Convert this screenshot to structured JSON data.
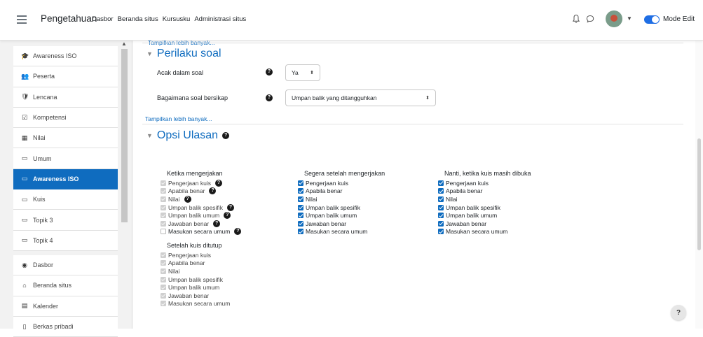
{
  "topbar": {
    "brand": "Pengetahuan",
    "nav": [
      "Dasbor",
      "Beranda situs",
      "Kursusku",
      "Administrasi situs"
    ],
    "mode_label": "Mode Edit",
    "icons": [
      "menu-icon",
      "bell-icon",
      "chat-icon",
      "avatar",
      "toggle"
    ]
  },
  "drawer": {
    "items": [
      {
        "label": "Awareness ISO",
        "icon": "graduation-cap-icon",
        "glyph": "🎓"
      },
      {
        "label": "Peserta",
        "icon": "users-icon",
        "glyph": "👥"
      },
      {
        "label": "Lencana",
        "icon": "shield-icon",
        "glyph": "🛡"
      },
      {
        "label": "Kompetensi",
        "icon": "checkbox-icon",
        "glyph": "☑"
      },
      {
        "label": "Nilai",
        "icon": "table-icon",
        "glyph": "▦"
      },
      {
        "label": "Umum",
        "icon": "folder-icon",
        "glyph": "▭"
      },
      {
        "label": "Awareness ISO",
        "icon": "folder-icon",
        "glyph": "▭",
        "active": true
      },
      {
        "label": "Kuis",
        "icon": "folder-icon",
        "glyph": "▭"
      },
      {
        "label": "Topik 3",
        "icon": "folder-icon",
        "glyph": "▭"
      },
      {
        "label": "Topik 4",
        "icon": "folder-icon",
        "glyph": "▭"
      },
      {
        "label": "Dasbor",
        "icon": "dashboard-icon",
        "glyph": "◉"
      },
      {
        "label": "Beranda situs",
        "icon": "home-icon",
        "glyph": "⌂"
      },
      {
        "label": "Kalender",
        "icon": "calendar-icon",
        "glyph": "▤"
      },
      {
        "label": "Berkas pribadi",
        "icon": "file-icon",
        "glyph": "▯"
      }
    ]
  },
  "main": {
    "show_more_1": "Tampilkan lebih banyak...",
    "perilaku": {
      "title": "Perilaku soal",
      "acak_label": "Acak dalam soal",
      "acak_value": "Ya",
      "bagaimana_label": "Bagaimana soal bersikap",
      "bagaimana_value": "Umpan balik yang ditangguhkan"
    },
    "show_more_2": "Tampilkan lebih banyak...",
    "opsi": {
      "title": "Opsi Ulasan",
      "columns": [
        {
          "title": "Ketika mengerjakan",
          "items": [
            {
              "label": "Pengerjaan kuis",
              "state": "disabled",
              "help": true
            },
            {
              "label": "Apabila benar",
              "state": "disabled",
              "help": true
            },
            {
              "label": "Nilai",
              "state": "disabled",
              "help": true
            },
            {
              "label": "Umpan balik spesifik",
              "state": "disabled",
              "help": true
            },
            {
              "label": "Umpan balik umum",
              "state": "disabled",
              "help": true
            },
            {
              "label": "Jawaban benar",
              "state": "disabled",
              "help": true
            },
            {
              "label": "Masukan secara umum",
              "state": "empty",
              "help": true
            }
          ]
        },
        {
          "title": "Segera setelah mengerjakan",
          "items": [
            {
              "label": "Pengerjaan kuis",
              "state": "checked"
            },
            {
              "label": "Apabila benar",
              "state": "checked"
            },
            {
              "label": "Nilai",
              "state": "checked"
            },
            {
              "label": "Umpan balik spesifik",
              "state": "checked"
            },
            {
              "label": "Umpan balik umum",
              "state": "checked"
            },
            {
              "label": "Jawaban benar",
              "state": "checked"
            },
            {
              "label": "Masukan secara umum",
              "state": "checked"
            }
          ]
        },
        {
          "title": "Nanti, ketika kuis masih dibuka",
          "items": [
            {
              "label": "Pengerjaan kuis",
              "state": "checked"
            },
            {
              "label": "Apabila benar",
              "state": "checked"
            },
            {
              "label": "Nilai",
              "state": "checked"
            },
            {
              "label": "Umpan balik spesifik",
              "state": "checked"
            },
            {
              "label": "Umpan balik umum",
              "state": "checked"
            },
            {
              "label": "Jawaban benar",
              "state": "checked"
            },
            {
              "label": "Masukan secara umum",
              "state": "checked"
            }
          ]
        },
        {
          "title": "Setelah kuis ditutup",
          "items": [
            {
              "label": "Pengerjaan kuis",
              "state": "disabled"
            },
            {
              "label": "Apabila benar",
              "state": "disabled"
            },
            {
              "label": "Nilai",
              "state": "disabled"
            },
            {
              "label": "Umpan balik spesifik",
              "state": "disabled"
            },
            {
              "label": "Umpan balik umum",
              "state": "disabled"
            },
            {
              "label": "Jawaban benar",
              "state": "disabled"
            },
            {
              "label": "Masukan secara umum",
              "state": "disabled"
            }
          ]
        }
      ]
    }
  },
  "help_fab": "?",
  "colors": {
    "accent": "#0f6cbf",
    "help_icon": "#1a1a1a",
    "toggle": "#1f6ee4"
  }
}
